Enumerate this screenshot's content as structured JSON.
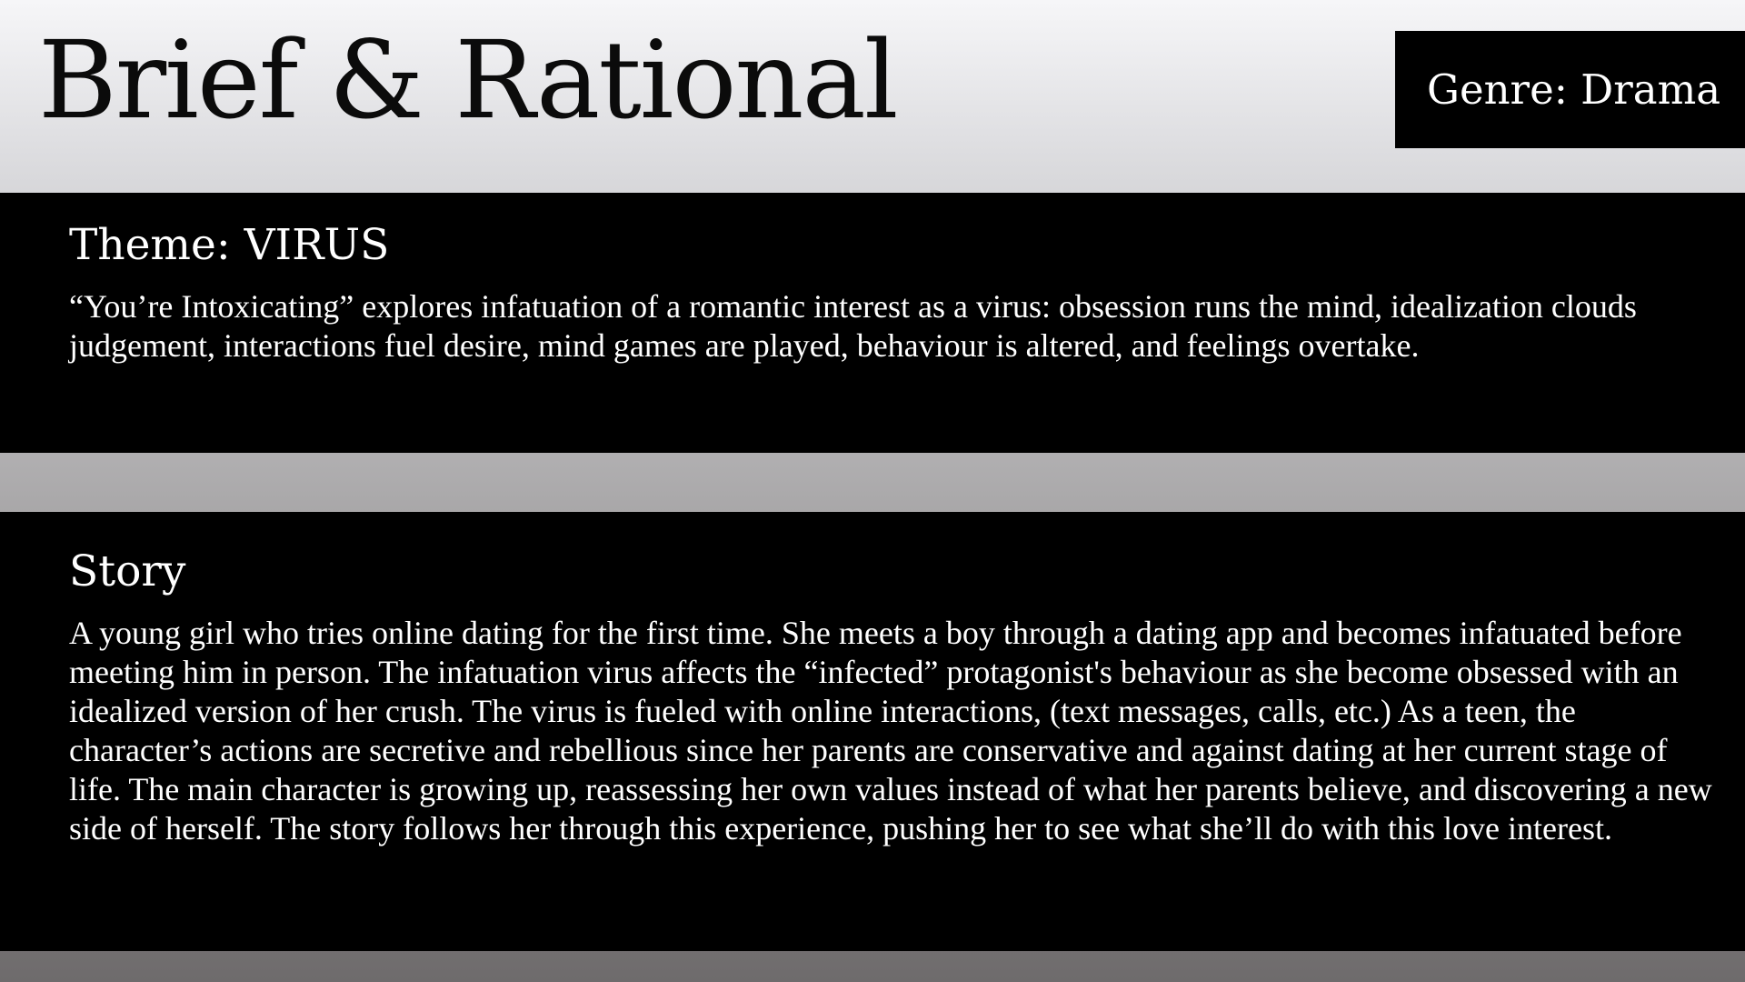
{
  "slide": {
    "title": "Brief & Rational",
    "genre_label": "Genre: Drama"
  },
  "theme": {
    "heading": "Theme: VIRUS",
    "body": "“You’re Intoxicating” explores infatuation of a romantic interest as a virus: obsession runs the mind, idealization clouds judgement, interactions fuel desire, mind games are played, behaviour is altered, and feelings overtake."
  },
  "story": {
    "heading": "Story",
    "body": "A young girl who tries online dating for the first time. She meets a boy through a dating app and becomes infatuated before meeting him in person. The infatuation virus affects the “infected” protagonist's behaviour as she become obsessed with an idealized version of her crush. The virus is fueled with online interactions, (text messages, calls, etc.) As a teen, the character’s actions are secretive and rebellious since her parents are conservative and against dating at her current stage of life. The main character is growing up, reassessing her own values instead of what her parents believe, and discovering a new side of herself. The story follows her through this experience, pushing her to see what she’ll do with this love interest."
  }
}
